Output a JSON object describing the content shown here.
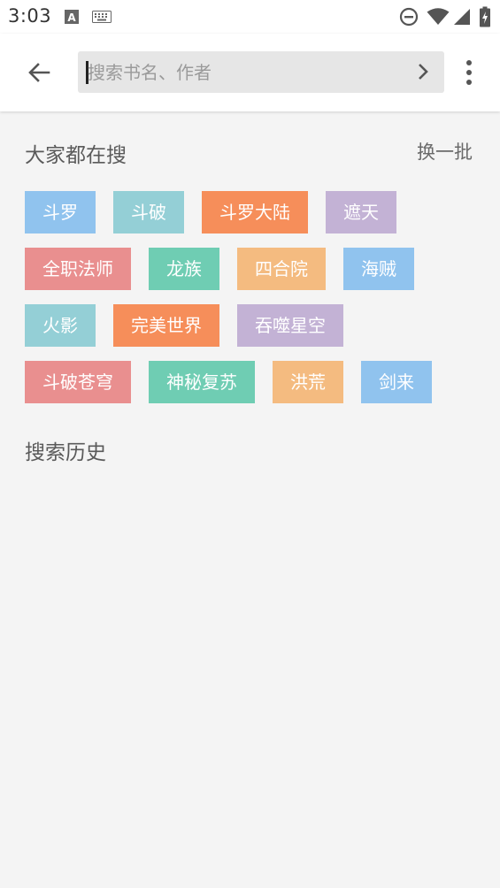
{
  "status_bar": {
    "time": "3:03",
    "icons": [
      "text-a-notification-icon",
      "keyboard-icon",
      "do-not-disturb-icon",
      "wifi-icon",
      "cell-signal-icon",
      "battery-charging-icon"
    ]
  },
  "toolbar": {
    "back_icon": "arrow-left-icon",
    "search_placeholder": "搜索书名、作者",
    "search_value": "",
    "go_icon": "chevron-right-icon",
    "more_icon": "more-vert-icon"
  },
  "hot_section": {
    "title": "大家都在搜",
    "refresh_label": "换一批",
    "tags": [
      {
        "label": "斗罗",
        "color": "#90c3ee"
      },
      {
        "label": "斗破",
        "color": "#94cfd6"
      },
      {
        "label": "斗罗大陆",
        "color": "#f68e5a"
      },
      {
        "label": "遮天",
        "color": "#c3b2d5"
      },
      {
        "label": "全职法师",
        "color": "#e98f8f"
      },
      {
        "label": "龙族",
        "color": "#6fcdb3"
      },
      {
        "label": "四合院",
        "color": "#f4bb80"
      },
      {
        "label": "海贼",
        "color": "#90c3ee"
      },
      {
        "label": "火影",
        "color": "#94cfd6"
      },
      {
        "label": "完美世界",
        "color": "#f68e5a"
      },
      {
        "label": "吞噬星空",
        "color": "#c3b2d5"
      },
      {
        "label": "斗破苍穹",
        "color": "#e98f8f"
      },
      {
        "label": "神秘复苏",
        "color": "#6fcdb3"
      },
      {
        "label": "洪荒",
        "color": "#f4bb80"
      },
      {
        "label": "剑来",
        "color": "#90c3ee"
      }
    ]
  },
  "history_section": {
    "title": "搜索历史"
  }
}
